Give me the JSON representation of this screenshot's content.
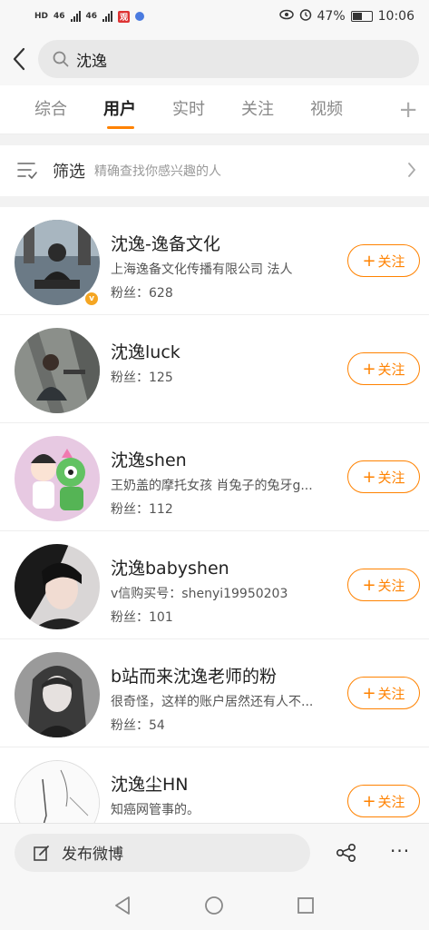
{
  "status_bar": {
    "left_badges": [
      "HD",
      "46",
      "46"
    ],
    "battery_percent": "47%",
    "time": "10:06"
  },
  "search": {
    "query": "沈逸"
  },
  "tabs": [
    {
      "label": "综合",
      "active": false
    },
    {
      "label": "用户",
      "active": true
    },
    {
      "label": "实时",
      "active": false
    },
    {
      "label": "关注",
      "active": false
    },
    {
      "label": "视频",
      "active": false
    }
  ],
  "filter": {
    "title": "筛选",
    "hint": "精确查找你感兴趣的人"
  },
  "users": [
    {
      "name": "沈逸-逸备文化",
      "desc": "上海逸备文化传播有限公司   法人",
      "fans": "粉丝：628",
      "follow": "关注",
      "verified": true
    },
    {
      "name": "沈逸luck",
      "desc": "",
      "fans": "粉丝：125",
      "follow": "关注",
      "verified": false
    },
    {
      "name": "沈逸shen",
      "desc": "王奶盖的摩托女孩   肖兔子的兔牙g...",
      "fans": "粉丝：112",
      "follow": "关注",
      "verified": false
    },
    {
      "name": "沈逸babyshen",
      "desc": "v信购买号：shenyi19950203",
      "fans": "粉丝：101",
      "follow": "关注",
      "verified": false
    },
    {
      "name": "b站而来沈逸老师的粉",
      "desc": "很奇怪，这样的账户居然还有人不...",
      "fans": "粉丝：54",
      "follow": "关注",
      "verified": false
    },
    {
      "name": "沈逸尘HN",
      "desc": "知癌网管事的。",
      "fans": "",
      "follow": "关注",
      "verified": false
    }
  ],
  "bottom": {
    "post_label": "发布微博",
    "more": "···"
  },
  "colors": {
    "accent": "#ff8200",
    "verified": "#f5a623"
  }
}
